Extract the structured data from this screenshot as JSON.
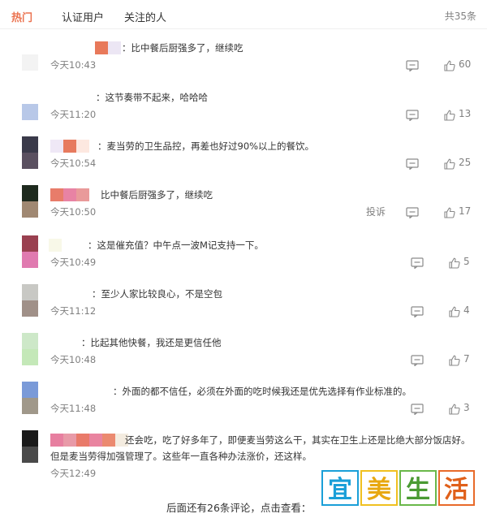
{
  "tabs": {
    "hot": "热门",
    "verified": "认证用户",
    "following": "关注的人"
  },
  "total": "共35条",
  "comments": [
    {
      "text": "：比中餐后厨强多了，继续吃",
      "time": "今天10:43",
      "likes": "60",
      "avatar_colors": [
        "#ffffff",
        "#f3f3f3"
      ],
      "name_colors": [
        "#e8795a",
        "#ece6f4"
      ]
    },
    {
      "text": "：这节奏带不起来，哈哈哈",
      "time": "今天11:20",
      "likes": "13",
      "avatar_colors": [
        "#ffffff",
        "#b8c8e8"
      ],
      "name_colors": []
    },
    {
      "text": "：麦当劳的卫生品控，再差也好过90%以上的餐饮。",
      "time": "今天10:54",
      "likes": "25",
      "avatar_colors": [
        "#3a3a4a",
        "#5a5060"
      ],
      "name_colors": [
        "#efe8f6",
        "#e77a5e",
        "#fde8e0"
      ]
    },
    {
      "text": "比中餐后厨强多了，继续吃",
      "time": "今天10:50",
      "likes": "17",
      "report": "投诉",
      "avatar_colors": [
        "#1e2a1e",
        "#a08872"
      ],
      "name_colors": [
        "#e87c6a",
        "#e883a4",
        "#e99a9a"
      ]
    },
    {
      "text": "：这是催充值？中午点一波M记支持一下。",
      "time": "今天10:49",
      "likes": "5",
      "avatar_colors": [
        "#9a4050",
        "#e07ab0"
      ],
      "name_colors": [
        "#f8f8e8"
      ]
    },
    {
      "text": "：至少人家比较良心，不是空包",
      "time": "今天11:12",
      "likes": "4",
      "avatar_colors": [
        "#c8c8c4",
        "#a09088"
      ],
      "name_colors": []
    },
    {
      "text": "：比起其他快餐，我还是更信任他",
      "time": "今天10:48",
      "likes": "7",
      "avatar_colors": [
        "#cde8c8",
        "#c4e8b8"
      ],
      "name_colors": []
    },
    {
      "text": "：外面的都不信任，必须在外面的吃时候我还是优先选择有作业标准的。",
      "time": "今天11:48",
      "likes": "3",
      "avatar_colors": [
        "#7a9ad8",
        "#a0988a"
      ],
      "name_colors": []
    },
    {
      "text": "还会吃，吃了好多年了，即便麦当劳这么干，其实在卫生上还是比绝大部分饭店好。",
      "text2": "但是麦当劳得加强管理了。这些年一直各种办法涨价，还这样。",
      "time": "今天12:49",
      "avatar_colors": [
        "#1a1a1a",
        "#4a4a4a"
      ],
      "name_colors": [
        "#e77fa0",
        "#e89aa8",
        "#e97a6a",
        "#e984a0",
        "#eb8a70",
        "#f4ece0"
      ]
    }
  ],
  "footer": {
    "more_text": "后面还有26条评论，点击查看："
  },
  "watermark": {
    "chars": [
      "宜",
      "美",
      "生",
      "活"
    ]
  }
}
